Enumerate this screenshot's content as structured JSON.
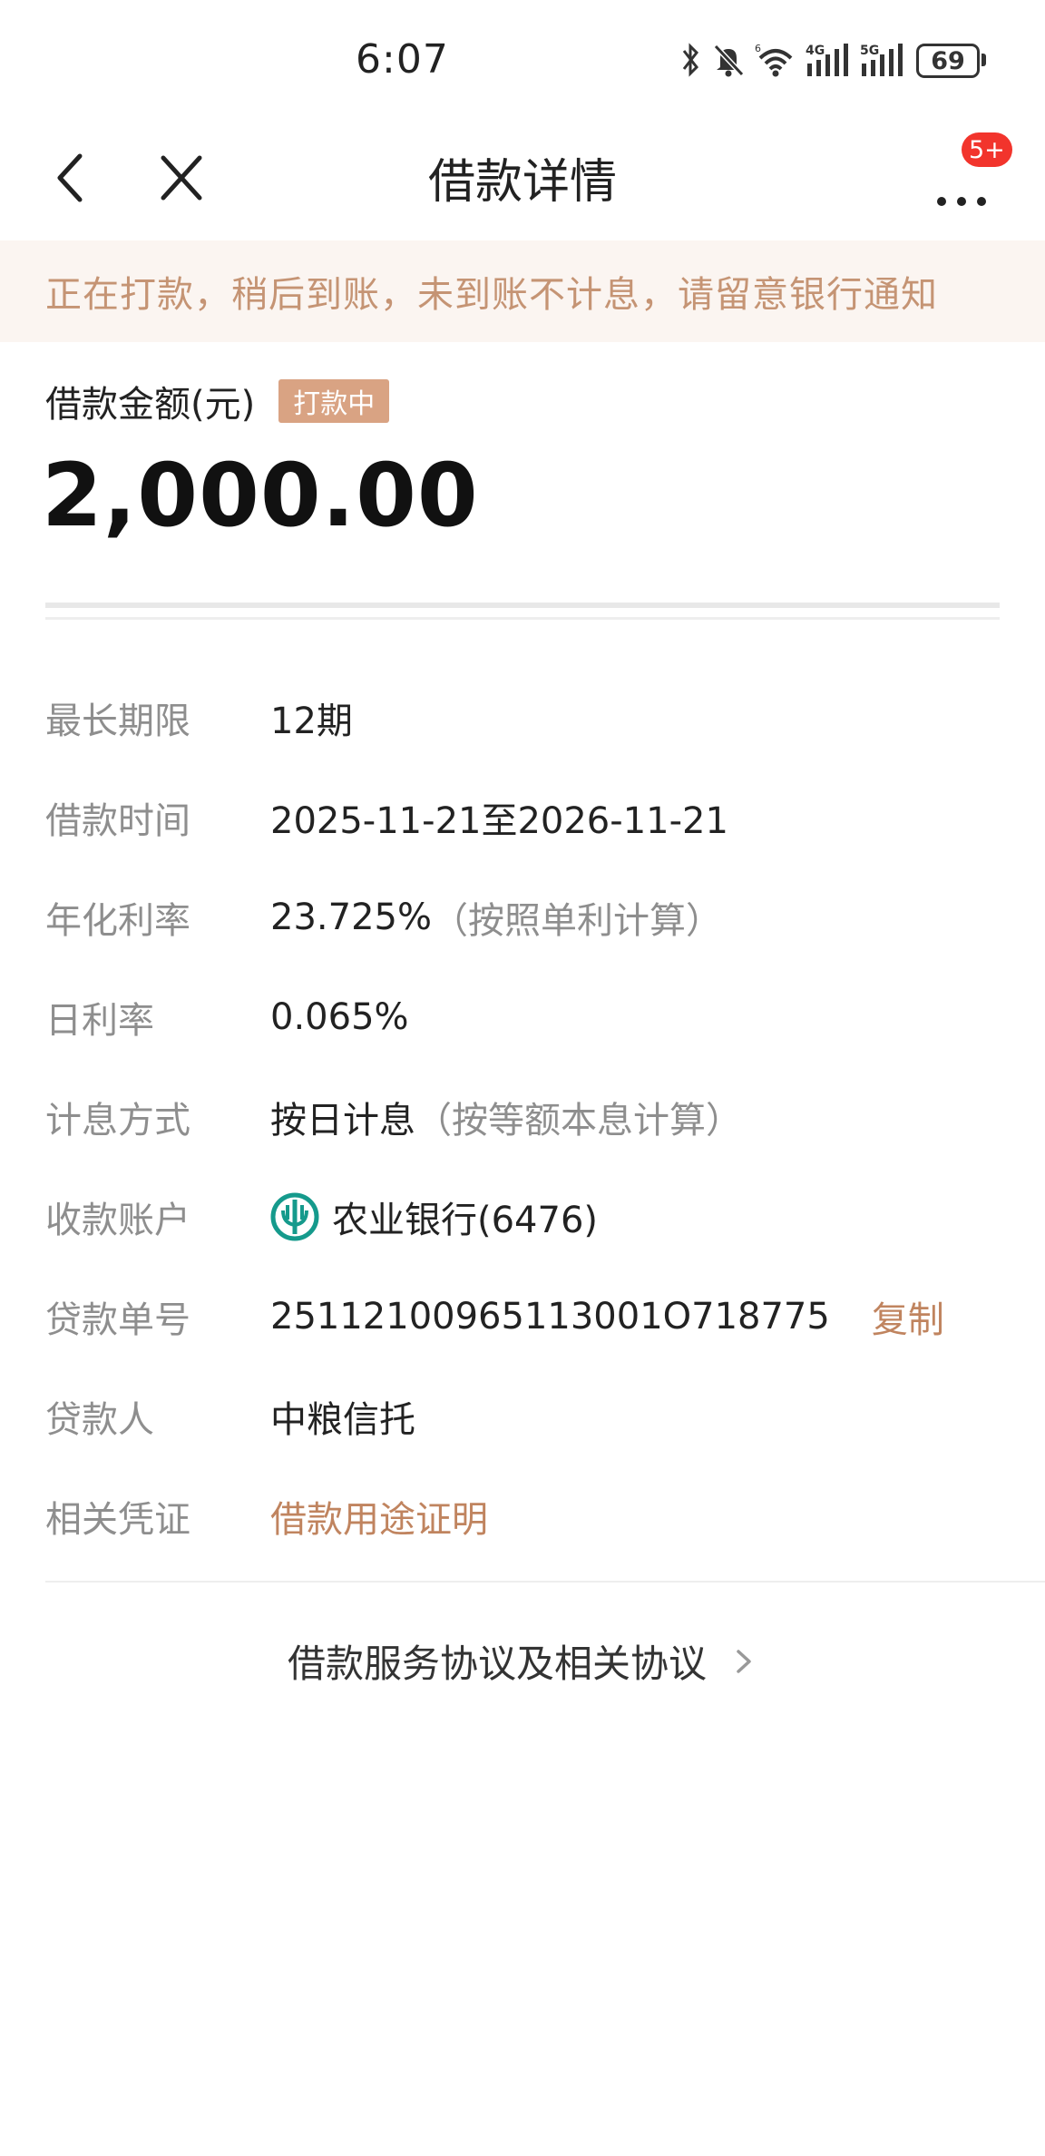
{
  "status_bar": {
    "time": "6:07",
    "battery": "69",
    "icons": [
      "bluetooth-icon",
      "mute-icon",
      "wifi-icon",
      "signal-4g-icon",
      "signal-5g-icon",
      "battery-icon"
    ],
    "signal_label_1": "4G",
    "signal_label_2": "5G",
    "wifi_sup": "6"
  },
  "nav": {
    "title": "借款详情",
    "badge": "5+"
  },
  "notice": "正在打款，稍后到账，未到账不计息，请留意银行通知",
  "amount": {
    "label": "借款金额(元)",
    "status_tag": "打款中",
    "value": "2,000.00"
  },
  "details": {
    "term": {
      "label": "最长期限",
      "value": "12期"
    },
    "loan_time": {
      "label": "借款时间",
      "value": "2025-11-21至2026-11-21"
    },
    "annual_rate": {
      "label": "年化利率",
      "value": "23.725%",
      "note": "（按照单利计算）"
    },
    "daily_rate": {
      "label": "日利率",
      "value": "0.065%"
    },
    "interest_method": {
      "label": "计息方式",
      "value": "按日计息",
      "note": "（按等额本息计算）"
    },
    "account": {
      "label": "收款账户",
      "value": "农业银行(6476)"
    },
    "loan_no": {
      "label": "贷款单号",
      "value": "25112100965113001O718775",
      "copy": "复制"
    },
    "lender": {
      "label": "贷款人",
      "value": "中粮信托"
    },
    "voucher": {
      "label": "相关凭证",
      "value": "借款用途证明"
    }
  },
  "agreement": "借款服务协议及相关协议",
  "colors": {
    "accent": "#c0845f",
    "notice_bg": "#fbf5f1",
    "tag_bg": "#d9a383",
    "badge": "#f2342c",
    "bank_logo": "#159a8c"
  }
}
